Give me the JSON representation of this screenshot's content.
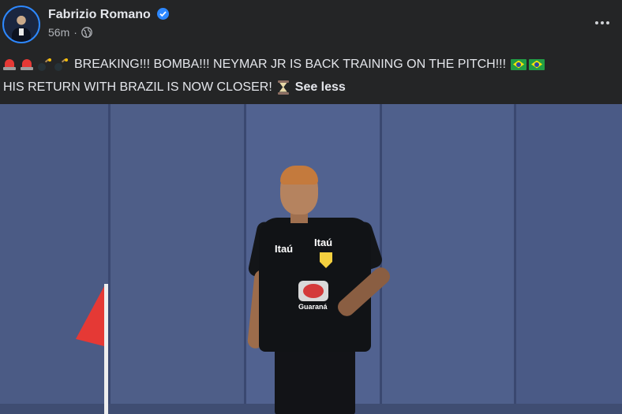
{
  "post": {
    "author": "Fabrizio Romano",
    "time": "56m",
    "separator": "·",
    "line1": "BREAKING!!! BOMBA!!! NEYMAR JR IS BACK TRAINING ON THE PITCH!!!",
    "line2": "HIS RETURN WITH BRAZIL IS NOW CLOSER!",
    "see_less": "See less",
    "jersey_sponsor_left": "Itaú",
    "jersey_sponsor_right": "Itaú",
    "badge_text": "Guaraná",
    "icons": {
      "verified": "verified-badge-icon",
      "audience": "globe-icon",
      "menu": "more-options-icon",
      "emoji_alarm": "police-light-icon",
      "emoji_bomb": "bomb-icon",
      "emoji_flag": "brazil-flag-icon",
      "emoji_hourglass": "hourglass-icon"
    }
  },
  "colors": {
    "background": "#242526",
    "text": "#e4e6eb",
    "secondary_text": "#b0b3b8",
    "accent": "#2d88ff"
  }
}
